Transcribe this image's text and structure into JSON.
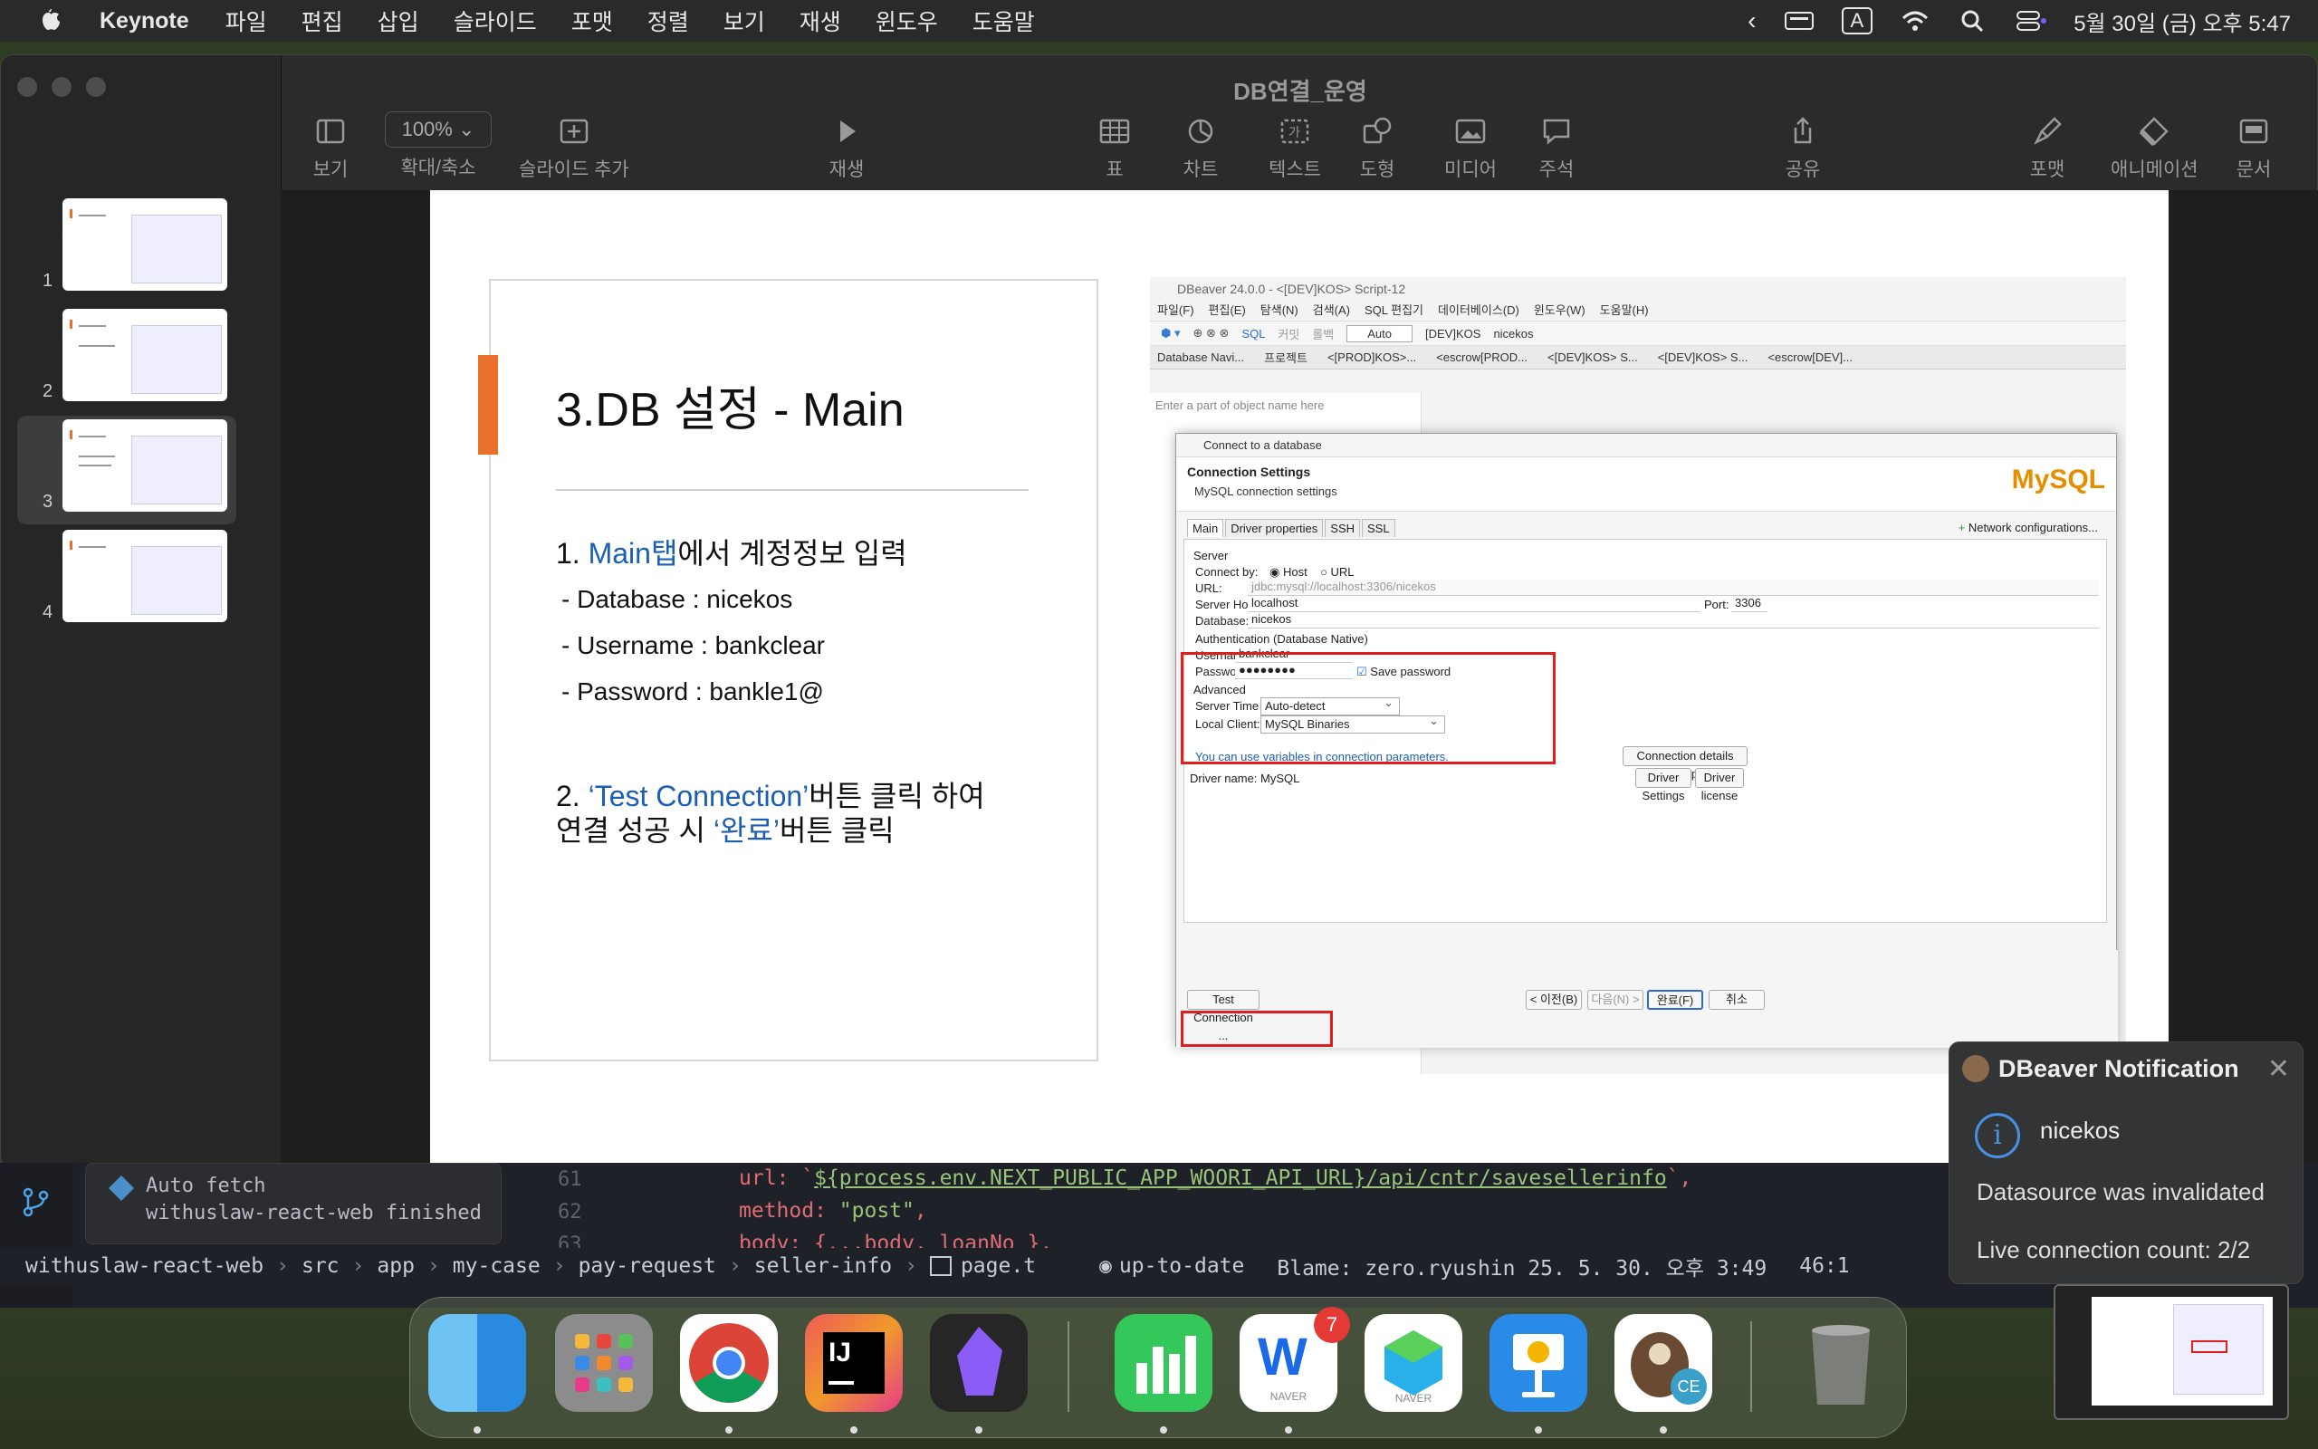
{
  "menubar": {
    "app_name": "Keynote",
    "items": [
      "파일",
      "편집",
      "삽입",
      "슬라이드",
      "포맷",
      "정렬",
      "보기",
      "재생",
      "윈도우",
      "도움말"
    ],
    "clock": "5월 30일 (금) 오후 5:47",
    "input_indicator": "A"
  },
  "keynote": {
    "title": "DB연결_운영",
    "toolbar": {
      "view": "보기",
      "zoom_value": "100%",
      "zoom": "확대/축소",
      "add_slide": "슬라이드 추가",
      "play": "재생",
      "table": "표",
      "chart": "차트",
      "text": "텍스트",
      "shape": "도형",
      "media": "미디어",
      "comment": "주석",
      "share": "공유",
      "format": "포맷",
      "animate": "애니메이션",
      "document": "문서"
    },
    "thumbnails": [
      "1",
      "2",
      "3",
      "4"
    ]
  },
  "slide": {
    "title": "3.DB 설정 - Main",
    "step1_prefix": "1. ",
    "step1_highlight": "Main탭",
    "step1_suffix": "에서 계정정보 입력",
    "database_line": "- Database : nicekos",
    "username_line": "- Username : bankclear",
    "password_line": "- Password : bankle1@",
    "step2_prefix": "2. ",
    "step2_highlight": "‘Test Connection’",
    "step2_suffix": "버튼 클릭 하여",
    "step2b_prefix": "연결 성공 시 ",
    "step2b_highlight": "‘완료’",
    "step2b_suffix": "버튼 클릭"
  },
  "dbeaver": {
    "window_title": "DBeaver 24.0.0 - <[DEV]KOS> Script-12",
    "menu": [
      "파일(F)",
      "편집(E)",
      "탐색(N)",
      "검색(A)",
      "SQL 편집기",
      "데이터베이스(D)",
      "윈도우(W)",
      "도움말(H)"
    ],
    "toolbar": {
      "sql": "SQL",
      "commit": "커밋",
      "rollback": "롤백",
      "auto": "Auto",
      "conn": "[DEV]KOS",
      "db": "nicekos"
    },
    "tabs": [
      "Database Navi...",
      "프로젝트",
      "<[PROD]KOS>...",
      "<escrow[PROD...",
      "<[DEV]KOS> S...",
      "<[DEV]KOS> S...",
      "<escrow[DEV]..."
    ],
    "filter_placeholder": "Enter a part of object name here",
    "dialog": {
      "title": "Connect to a database",
      "heading": "Connection Settings",
      "subheading": "MySQL connection settings",
      "logo": "MySQL",
      "tabs": [
        "Main",
        "Driver properties",
        "SSH",
        "SSL"
      ],
      "network": "Network configurations...",
      "server_group": "Server",
      "connect_by": "Connect by:",
      "host_opt": "Host",
      "url_opt": "URL",
      "url_label": "URL:",
      "url_value": "jdbc:mysql://localhost:3306/nicekos",
      "host_label": "Server Host:",
      "host_value": "localhost",
      "port_label": "Port:",
      "port_value": "3306",
      "db_label": "Database:",
      "db_value": "nicekos",
      "auth_group": "Authentication (Database Native)",
      "user_label": "Username:",
      "user_value": "bankclear",
      "pass_label": "Password:",
      "pass_value": "●●●●●●●●",
      "save_pw": "Save password",
      "advanced": "Advanced",
      "tz_label": "Server Time Zone:",
      "tz_value": "Auto-detect",
      "client_label": "Local Client:",
      "client_value": "MySQL Binaries",
      "vars_link": "You can use variables in connection parameters.",
      "details_btn": "Connection details (name, type, ... )",
      "driver_label": "Driver name:",
      "driver_value": "MySQL",
      "driver_settings": "Driver Settings",
      "driver_license": "Driver license",
      "test_btn": "Test Connection ...",
      "back_btn": "< 이전(B)",
      "next_btn": "다음(N) >",
      "finish_btn": "완료(F)",
      "cancel_btn": "취소"
    }
  },
  "editor": {
    "line_61": "61",
    "line_62": "62",
    "line_63": "63",
    "code_61_prefix": "url: `",
    "code_61_tmpl": "${process.env.NEXT_PUBLIC_APP_WOORI_API_URL}/api/cntr/savesellerinfo",
    "code_61_suffix": "`,",
    "code_62_prefix": "method: ",
    "code_62_str": "\"post\"",
    "code_62_suffix": ",",
    "code_63": "body: {...body, loanNo },",
    "git_toast_line1": "Auto fetch",
    "git_toast_line2": "withuslaw-react-web finished"
  },
  "statusbar": {
    "path": [
      "withuslaw-react-web",
      "src",
      "app",
      "my-case",
      "pay-request",
      "seller-info",
      "page.t"
    ],
    "vcs": "up-to-date",
    "blame": "Blame: zero.ryushin 25. 5. 30. 오후 3:49",
    "position": "46:1"
  },
  "notification": {
    "title": "DBeaver Notification",
    "name": "nicekos",
    "message": "Datasource was invalidated",
    "count": "Live connection count: 2/2"
  },
  "dock": {
    "apps": [
      "finder-icon",
      "launchpad-icon",
      "chrome-icon",
      "intellij-icon",
      "obsidian-icon",
      "numbers-icon",
      "naver-whale-icon",
      "naver-works-icon",
      "keynote-icon",
      "dbeaver-icon",
      "trash-icon"
    ],
    "badge": "7",
    "whale_label": "NAVER",
    "works_label": "NAVER",
    "dbeaver_label": "CE"
  },
  "colors": {
    "accent_orange": "#e8702a",
    "link_blue": "#1a5fb4",
    "highlight_red": "#e01e1e"
  }
}
